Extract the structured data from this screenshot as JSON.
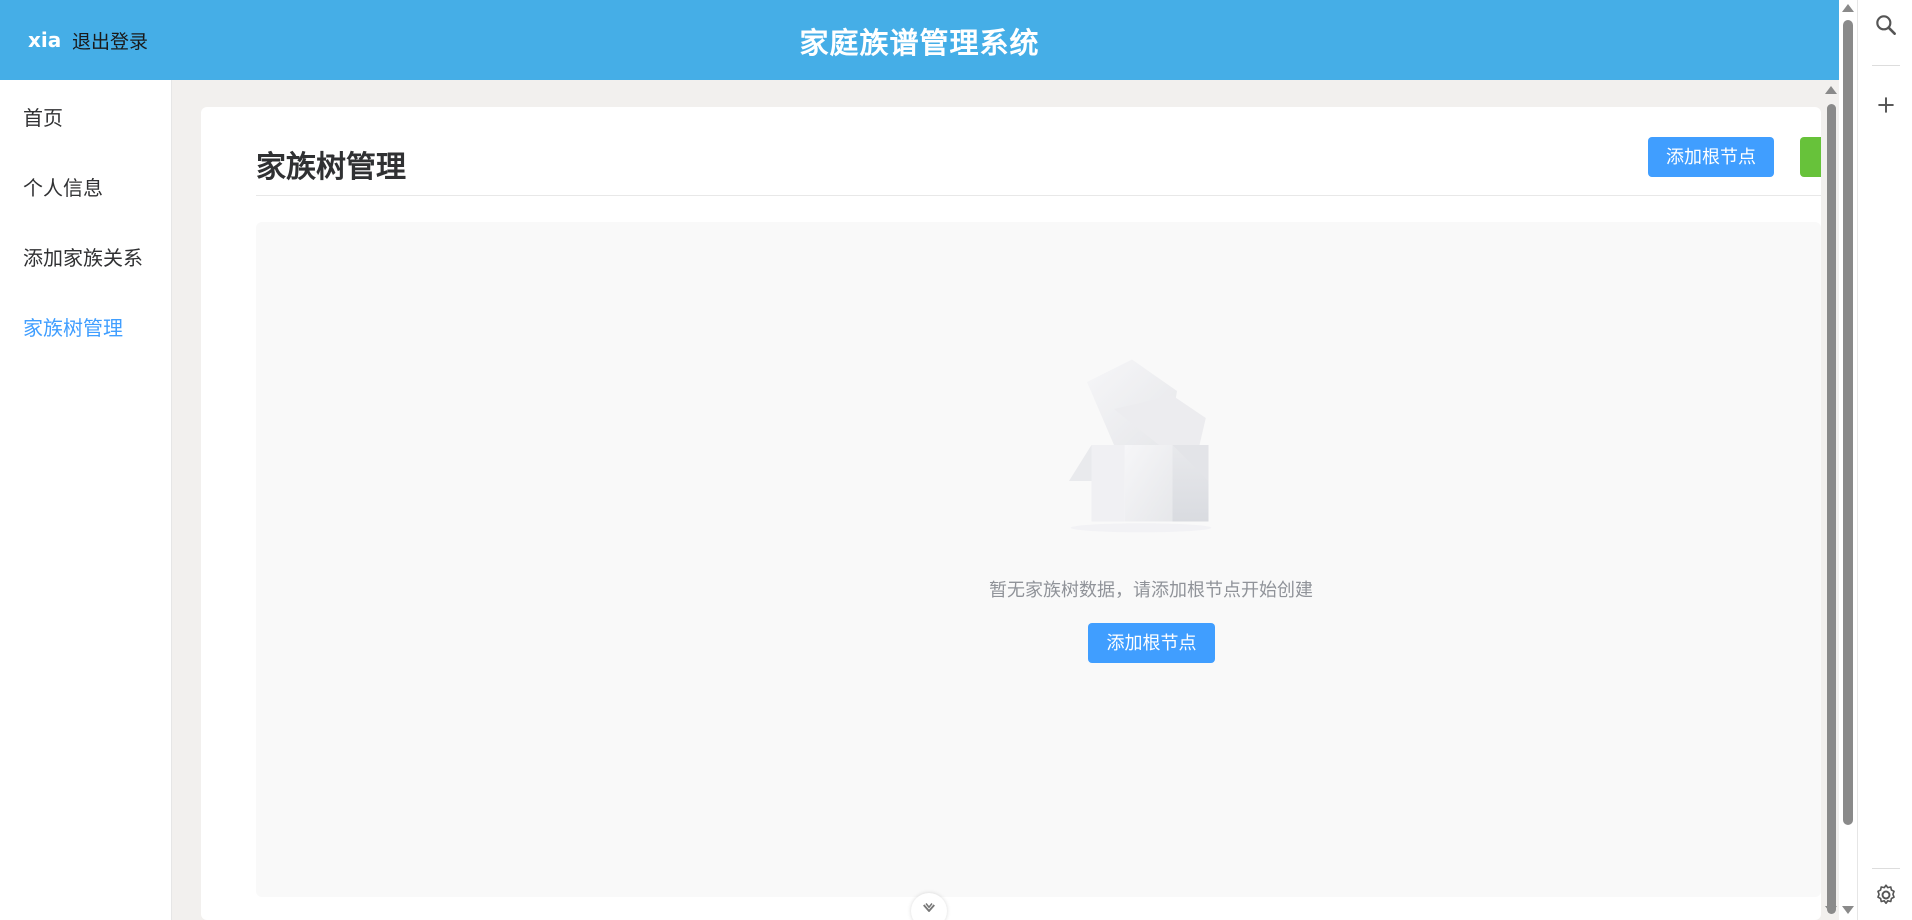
{
  "header": {
    "user": "xia",
    "logout_label": "退出登录",
    "app_title": "家庭族谱管理系统"
  },
  "sidebar": {
    "items": [
      {
        "label": "首页",
        "active": false
      },
      {
        "label": "个人信息",
        "active": false
      },
      {
        "label": "添加家族关系",
        "active": false
      },
      {
        "label": "家族树管理",
        "active": true
      }
    ]
  },
  "main": {
    "page_title": "家族树管理",
    "add_root_label": "添加根节点",
    "empty_text": "暂无家族树数据，请添加根节点开始创建",
    "empty_add_root_label": "添加根节点"
  },
  "colors": {
    "header_bg": "#45aee7",
    "primary": "#409eff",
    "success": "#67c23a",
    "active_text": "#409eff"
  },
  "icons": {
    "search": "search-icon",
    "add": "plus-icon",
    "settings": "gear-icon",
    "empty": "empty-box-icon",
    "scroll_down": "chevron-down-icon"
  }
}
